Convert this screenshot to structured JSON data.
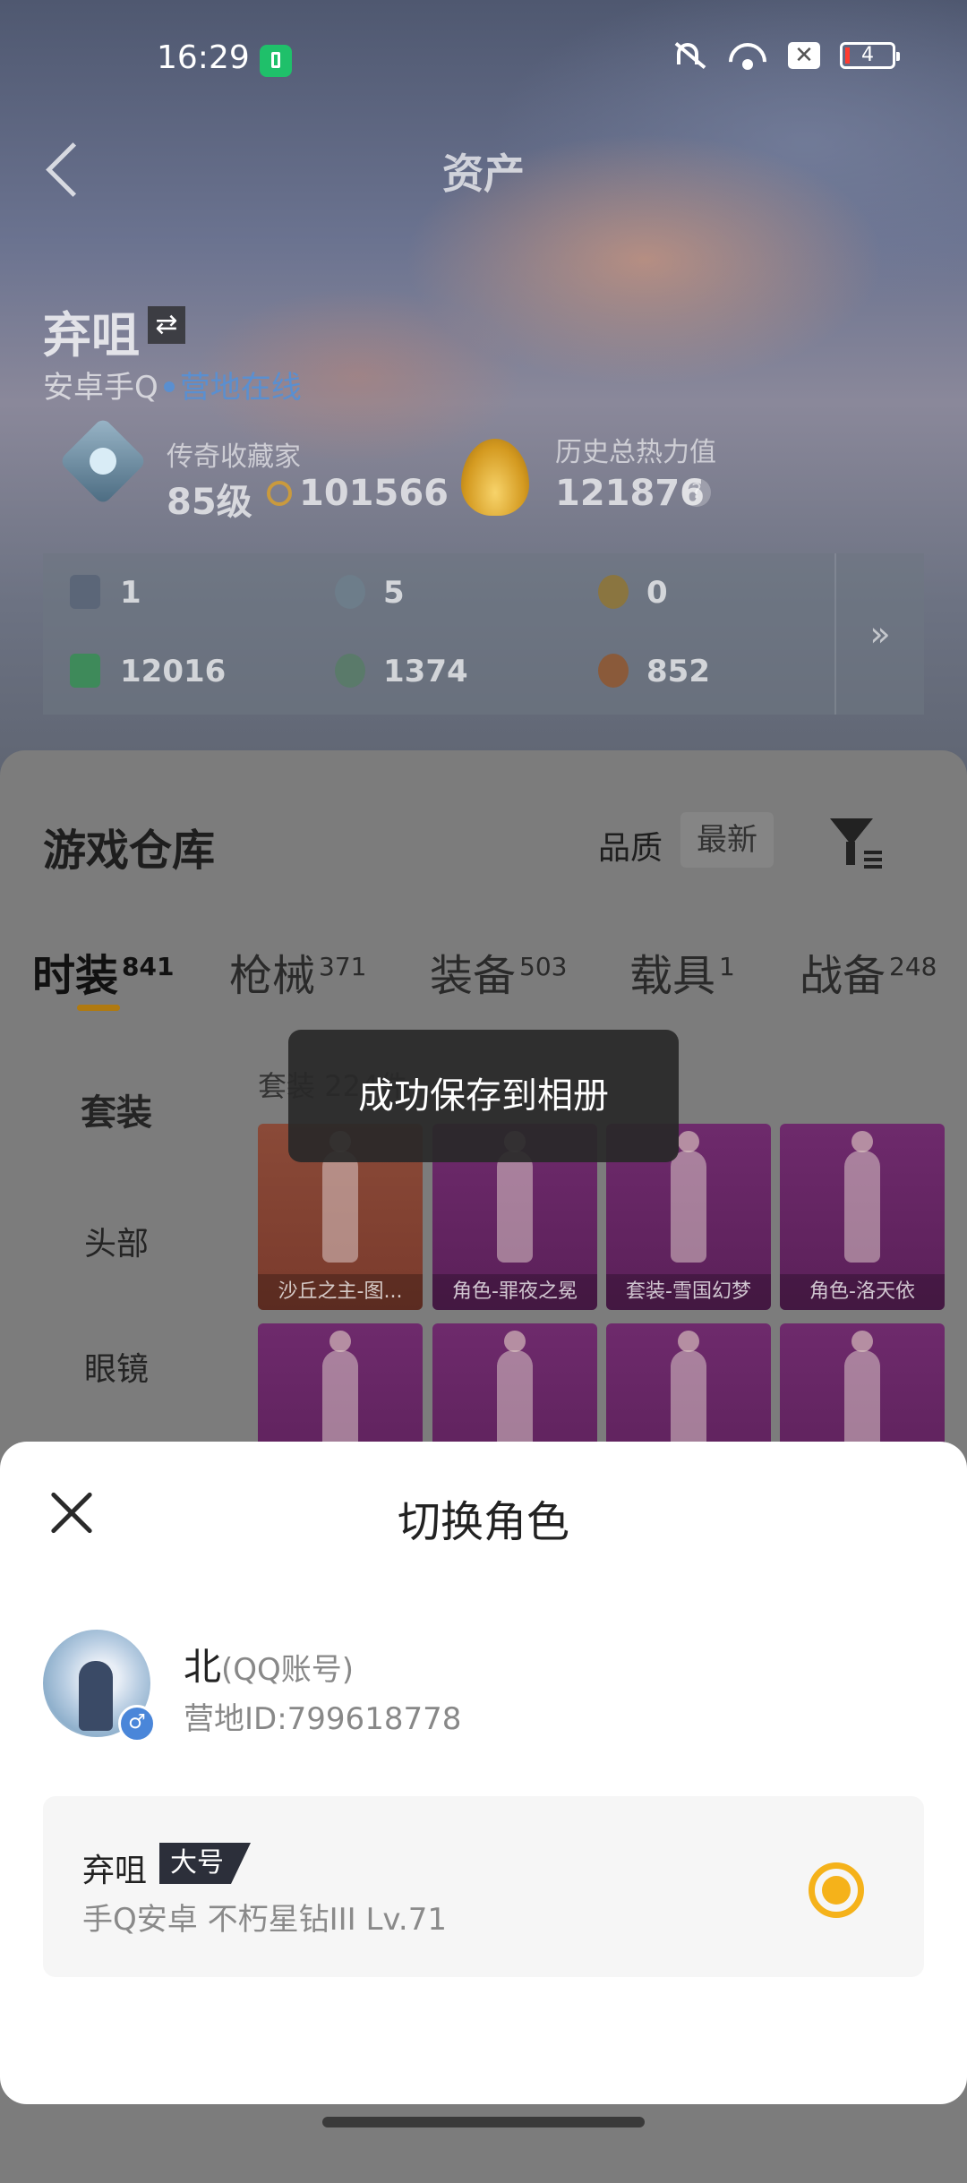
{
  "status_bar": {
    "time": "16:29",
    "battery": "4",
    "close_badge": "✕"
  },
  "header": {
    "title": "资产"
  },
  "profile": {
    "name": "弃咀",
    "swap_icon": "⇄",
    "platform": "安卓手Q",
    "online_status": "营地在线",
    "rank_title": "传奇收藏家",
    "rank_level": "85级",
    "coins": "101566",
    "heat_label": "历史总热力值",
    "heat_value": "121876",
    "help": "?"
  },
  "assets": {
    "row1": [
      "1",
      "5",
      "0"
    ],
    "row2": [
      "12016",
      "1374",
      "852"
    ],
    "more": "»"
  },
  "warehouse": {
    "title": "游戏仓库",
    "quality_label": "品质",
    "sort_label": "最新",
    "tabs": [
      {
        "label": "时装",
        "count": "841"
      },
      {
        "label": "枪械",
        "count": "371"
      },
      {
        "label": "装备",
        "count": "503"
      },
      {
        "label": "载具",
        "count": "1"
      },
      {
        "label": "战备",
        "count": "248"
      }
    ],
    "side_items": [
      "套装",
      "头部",
      "眼镜"
    ],
    "grid_title": "套装 224件",
    "items": [
      "沙丘之主-图...",
      "角色-罪夜之冕",
      "套装-雪国幻梦",
      "角色-洛天依",
      "",
      "",
      "",
      ""
    ]
  },
  "toast": {
    "text": "成功保存到相册"
  },
  "modal": {
    "title": "切换角色",
    "account_name": "北",
    "account_type": "(QQ账号)",
    "account_id": "营地ID:799618778",
    "gender_icon": "♂",
    "role": {
      "name": "弃咀",
      "tag": "大号",
      "detail": "手Q安卓  不朽星钻III  Lv.71"
    }
  },
  "colors": {
    "accent": "#f5b21a",
    "online": "#5a8fd0",
    "tab_indicator": "#b07a10"
  }
}
